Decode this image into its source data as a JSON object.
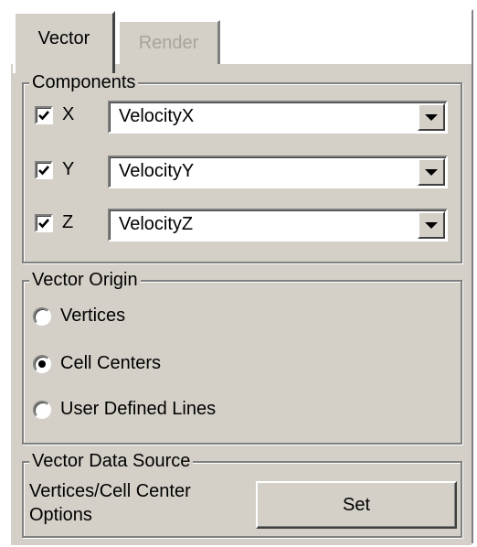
{
  "tabs": [
    {
      "label": "Vector",
      "active": true
    },
    {
      "label": "Render",
      "active": false
    }
  ],
  "components": {
    "title": "Components",
    "rows": [
      {
        "axis": "X",
        "checked": true,
        "value": "VelocityX"
      },
      {
        "axis": "Y",
        "checked": true,
        "value": "VelocityY"
      },
      {
        "axis": "Z",
        "checked": true,
        "value": "VelocityZ"
      }
    ]
  },
  "vector_origin": {
    "title": "Vector Origin",
    "options": [
      {
        "label": "Vertices",
        "selected": false
      },
      {
        "label": "Cell Centers",
        "selected": true
      },
      {
        "label": "User Defined Lines",
        "selected": false
      }
    ]
  },
  "vector_data_source": {
    "title": "Vector Data Source",
    "label_line1": "Vertices/Cell Center",
    "label_line2": "Options",
    "button_label": "Set"
  },
  "colors": {
    "face": "#d4d0c8",
    "highlight": "#ffffff",
    "shadow": "#808080",
    "disabled_text": "#a8a49c"
  },
  "icons": {
    "checkbox_mark": "check-icon",
    "dropdown": "chevron-down-icon"
  }
}
